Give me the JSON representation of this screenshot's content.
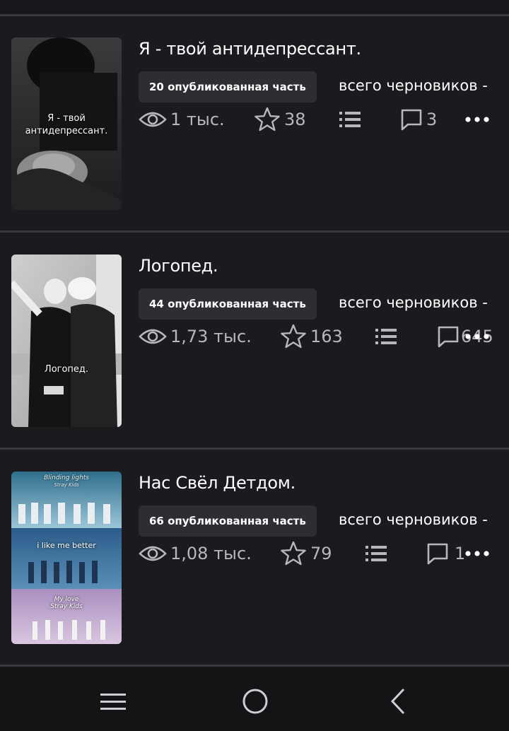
{
  "stories": [
    {
      "title": "Я - твой антидепрессант.",
      "cover_caption": [
        "Я - твой",
        "антидепрессант."
      ],
      "published": "20 опубликованная часть",
      "drafts": "всего черновиков -",
      "views": "1 тыс.",
      "stars": "38",
      "comments": "3"
    },
    {
      "title": "Логопед.",
      "cover_caption": [
        "Логопед."
      ],
      "published": "44 опубликованная часть",
      "drafts": "всего черновиков -",
      "views": "1,73 тыс.",
      "stars": "163",
      "comments": "645"
    },
    {
      "title": "Нас Свёл Детдом.",
      "cover_caption": [
        "Blinding lights",
        "Stray Kids",
        "i like me better",
        "My love",
        "Stray Kids"
      ],
      "published": "66 опубликованная часть",
      "drafts": "всего черновиков -",
      "views": "1,08 тыс.",
      "stars": "79",
      "comments": "1"
    }
  ],
  "icons": {
    "views": "eye-icon",
    "stars": "star-icon",
    "parts": "list-icon",
    "comments": "comment-icon",
    "more": "more-dots-icon",
    "nav_recent": "recent-apps-icon",
    "nav_home": "home-circle-icon",
    "nav_back": "back-chevron-icon"
  },
  "colors": {
    "background": "#1b1a1f",
    "badge": "#2f2d33",
    "icon": "#b9b7bd",
    "divider": "#3a383e",
    "navbar": "#141316"
  }
}
